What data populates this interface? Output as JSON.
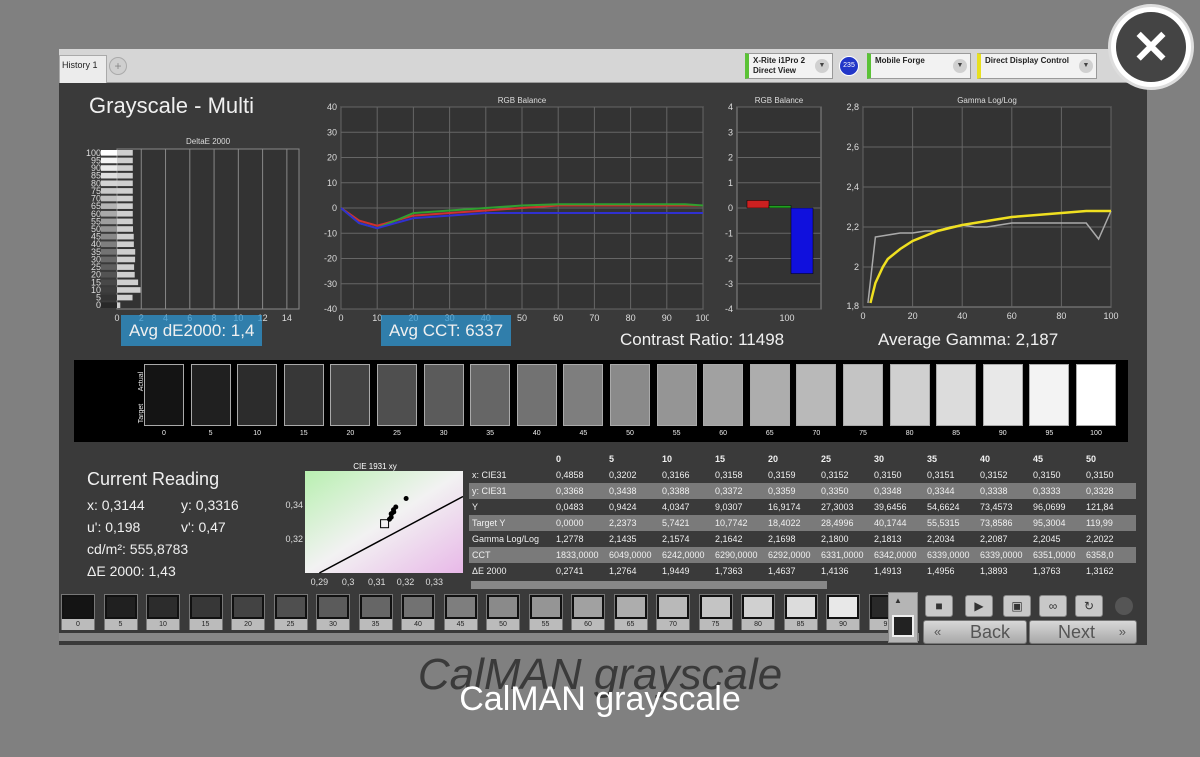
{
  "tab": {
    "label": "History 1",
    "add": "+"
  },
  "devices": [
    {
      "line1": "X-Rite i1Pro 2",
      "line2": "Direct View"
    },
    {
      "line1": "Mobile Forge",
      "line2": ""
    },
    {
      "line1": "Direct Display Control",
      "line2": ""
    }
  ],
  "badge": "235",
  "page_title": "Grayscale - Multi",
  "stats": {
    "avg_de": "Avg dE2000: 1,4",
    "avg_cct": "Avg CCT: 6337",
    "contrast": "Contrast Ratio: 11498",
    "avg_gamma": "Average Gamma: 2,187"
  },
  "strip": {
    "actual_label": "Actual",
    "target_label": "Target",
    "levels": [
      "0",
      "5",
      "10",
      "15",
      "20",
      "25",
      "30",
      "35",
      "40",
      "45",
      "50",
      "55",
      "60",
      "65",
      "70",
      "75",
      "80",
      "85",
      "90",
      "95",
      "100"
    ]
  },
  "current_reading": {
    "title": "Current Reading",
    "x": "x: 0,3144",
    "y": "y: 0,3316",
    "u": "u': 0,198",
    "v": "v': 0,47",
    "cdm": "cd/m²: 555,8783",
    "de": "ΔE 2000: 1,43"
  },
  "table": {
    "headers": [
      "",
      "0",
      "5",
      "10",
      "15",
      "20",
      "25",
      "30",
      "35",
      "40",
      "45",
      "50"
    ],
    "rows": [
      {
        "label": "x: CIE31",
        "values": [
          "0,4858",
          "0,3202",
          "0,3166",
          "0,3158",
          "0,3159",
          "0,3152",
          "0,3150",
          "0,3151",
          "0,3152",
          "0,3150",
          "0,3150"
        ]
      },
      {
        "label": "y: CIE31",
        "values": [
          "0,3368",
          "0,3438",
          "0,3388",
          "0,3372",
          "0,3359",
          "0,3350",
          "0,3348",
          "0,3344",
          "0,3338",
          "0,3333",
          "0,3328"
        ]
      },
      {
        "label": "Y",
        "values": [
          "0,0483",
          "0,9424",
          "4,0347",
          "9,0307",
          "16,9174",
          "27,3003",
          "39,6456",
          "54,6624",
          "73,4573",
          "96,0699",
          "121,84"
        ]
      },
      {
        "label": "Target Y",
        "values": [
          "0,0000",
          "2,2373",
          "5,7421",
          "10,7742",
          "18,4022",
          "28,4996",
          "40,1744",
          "55,5315",
          "73,8586",
          "95,3004",
          "119,99"
        ]
      },
      {
        "label": "Gamma Log/Log",
        "values": [
          "1,2778",
          "2,1435",
          "2,1574",
          "2,1642",
          "2,1698",
          "2,1800",
          "2,1813",
          "2,2034",
          "2,2087",
          "2,2045",
          "2,2022"
        ]
      },
      {
        "label": "CCT",
        "values": [
          "1833,0000",
          "6049,0000",
          "6242,0000",
          "6290,0000",
          "6292,0000",
          "6331,0000",
          "6342,0000",
          "6339,0000",
          "6339,0000",
          "6351,0000",
          "6358,0"
        ]
      },
      {
        "label": "ΔE 2000",
        "values": [
          "0,2741",
          "1,2764",
          "1,9449",
          "1,7363",
          "1,4637",
          "1,4136",
          "1,4913",
          "1,4956",
          "1,3893",
          "1,3763",
          "1,3162"
        ]
      }
    ]
  },
  "swatches": [
    "0",
    "5",
    "10",
    "15",
    "20",
    "25",
    "30",
    "35",
    "40",
    "45",
    "50",
    "55",
    "60",
    "65",
    "70",
    "75",
    "80",
    "85",
    "90",
    "9"
  ],
  "nav": {
    "back": "Back",
    "next": "Next"
  },
  "caption": "CalMAN grayscale",
  "caption_shadow": "CalMAN grayscale",
  "chart_data": [
    {
      "type": "bar",
      "title": "DeltaE 2000",
      "orientation": "horizontal",
      "y_ticks": [
        "0",
        "5",
        "10",
        "15",
        "20",
        "25",
        "30",
        "35",
        "40",
        "45",
        "50",
        "55",
        "60",
        "65",
        "70",
        "75",
        "80",
        "85",
        "90",
        "95",
        "100"
      ],
      "x_ticks": [
        "0",
        "2",
        "4",
        "6",
        "8",
        "10",
        "12",
        "14"
      ],
      "xlim": [
        0,
        15
      ],
      "values": [
        0.27,
        1.28,
        1.94,
        1.74,
        1.46,
        1.41,
        1.49,
        1.5,
        1.39,
        1.38,
        1.32,
        1.3,
        1.3,
        1.3,
        1.3,
        1.3,
        1.3,
        1.3,
        1.3,
        1.3,
        1.3
      ]
    },
    {
      "type": "line",
      "title": "RGB Balance",
      "xlim": [
        0,
        100
      ],
      "ylim": [
        -40,
        40
      ],
      "x_ticks": [
        "0",
        "10",
        "20",
        "30",
        "40",
        "50",
        "60",
        "70",
        "80",
        "90",
        "100"
      ],
      "y_ticks": [
        "40",
        "30",
        "20",
        "10",
        "0",
        "-10",
        "-20",
        "-30",
        "-40"
      ],
      "x": [
        0,
        5,
        10,
        15,
        20,
        30,
        40,
        50,
        60,
        70,
        80,
        90,
        95,
        100
      ],
      "series": [
        {
          "name": "Red",
          "color": "#d03030",
          "values": [
            0,
            -5,
            -7,
            -5,
            -3,
            -2,
            -1,
            0,
            1,
            1,
            1,
            1,
            1,
            1
          ]
        },
        {
          "name": "Green",
          "color": "#30a030",
          "values": [
            0,
            -6,
            -8,
            -5,
            -2,
            -1,
            0,
            1,
            1.5,
            1.5,
            1.5,
            1.5,
            1.5,
            1
          ]
        },
        {
          "name": "Blue",
          "color": "#3030d0",
          "values": [
            0,
            -6,
            -8,
            -6,
            -4,
            -3,
            -2,
            -2,
            -2,
            -2,
            -2,
            -2,
            -2,
            -2
          ]
        }
      ]
    },
    {
      "type": "bar",
      "title": "RGB Balance",
      "categories": [
        "100"
      ],
      "ylim": [
        -4,
        4
      ],
      "y_ticks": [
        "4",
        "3",
        "2",
        "1",
        "0",
        "-1",
        "-2",
        "-3",
        "-4"
      ],
      "series": [
        {
          "name": "Red",
          "color": "#cc2020",
          "values": [
            0.3
          ]
        },
        {
          "name": "Green",
          "color": "#20a020",
          "values": [
            0.1
          ]
        },
        {
          "name": "Blue",
          "color": "#1010dd",
          "values": [
            -2.6
          ]
        }
      ]
    },
    {
      "type": "line",
      "title": "Gamma Log/Log",
      "xlim": [
        0,
        100
      ],
      "ylim": [
        1.8,
        2.8
      ],
      "x_ticks": [
        "0",
        "20",
        "40",
        "60",
        "80",
        "100"
      ],
      "y_ticks": [
        "2,8",
        "2,6",
        "2,4",
        "2,2",
        "2"
      ],
      "y_extra_tick": "1,8",
      "series": [
        {
          "name": "Measured",
          "color": "#aaaaaa",
          "x": [
            2,
            5,
            10,
            15,
            20,
            25,
            30,
            35,
            40,
            45,
            50,
            55,
            60,
            65,
            70,
            75,
            80,
            85,
            90,
            95,
            100
          ],
          "values": [
            1.82,
            2.15,
            2.16,
            2.17,
            2.17,
            2.18,
            2.18,
            2.2,
            2.21,
            2.2,
            2.2,
            2.21,
            2.22,
            2.22,
            2.22,
            2.22,
            2.22,
            2.22,
            2.22,
            2.14,
            2.28
          ]
        },
        {
          "name": "Target",
          "color": "#f0e020",
          "x": [
            3,
            5,
            8,
            10,
            15,
            20,
            30,
            40,
            50,
            60,
            70,
            80,
            90,
            100
          ],
          "values": [
            1.82,
            1.92,
            2.0,
            2.04,
            2.09,
            2.13,
            2.18,
            2.21,
            2.23,
            2.25,
            2.26,
            2.27,
            2.28,
            2.28
          ]
        }
      ]
    },
    {
      "type": "scatter",
      "title": "CIE 1931 xy",
      "xlim": [
        0.285,
        0.34
      ],
      "ylim": [
        0.3,
        0.36
      ],
      "x_ticks": [
        "0,29",
        "0,3",
        "0,31",
        "0,32",
        "0,33"
      ],
      "y_ticks": [
        "0,34",
        "0,32"
      ],
      "points": [
        [
          0.3202,
          0.3438
        ],
        [
          0.3166,
          0.3388
        ],
        [
          0.3158,
          0.3372
        ],
        [
          0.3159,
          0.3359
        ],
        [
          0.3152,
          0.335
        ],
        [
          0.315,
          0.3348
        ],
        [
          0.315,
          0.3328
        ],
        [
          0.3144,
          0.3316
        ]
      ],
      "target": [
        0.3127,
        0.329
      ]
    }
  ]
}
